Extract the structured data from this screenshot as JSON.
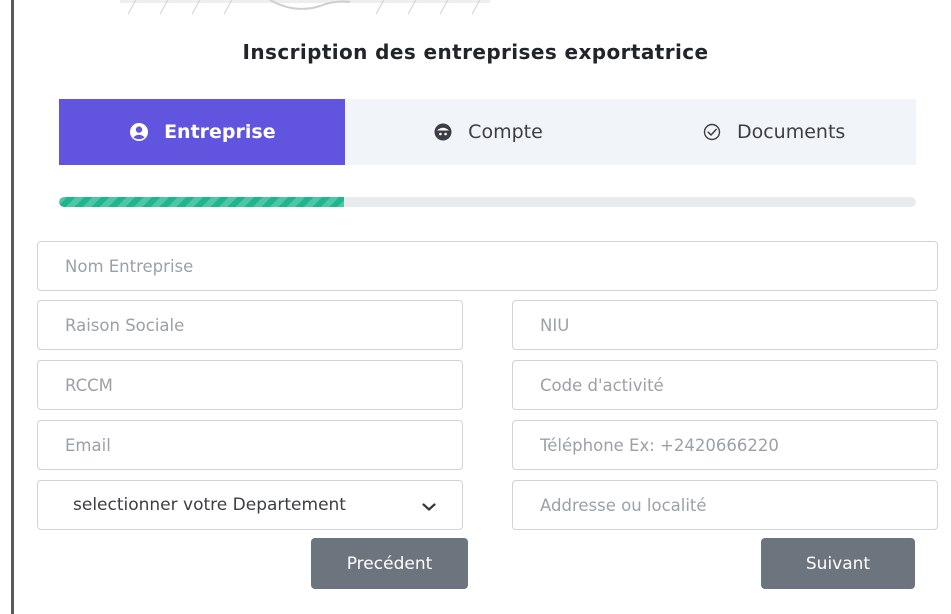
{
  "form": {
    "title": "Inscription des entreprises exportatrice",
    "progress_fraction": 0.333,
    "tabs": [
      {
        "label": "Entreprise",
        "icon": "user-circle-icon",
        "active": true
      },
      {
        "label": "Compte",
        "icon": "account-face-icon",
        "active": false
      },
      {
        "label": "Documents",
        "icon": "check-circle-icon",
        "active": false
      }
    ],
    "fields": {
      "nom_entreprise": {
        "placeholder": "Nom Entreprise",
        "value": ""
      },
      "raison_sociale": {
        "placeholder": "Raison Sociale",
        "value": ""
      },
      "niu": {
        "placeholder": "NIU",
        "value": ""
      },
      "rccm": {
        "placeholder": "RCCM",
        "value": ""
      },
      "code_activite": {
        "placeholder": "Code d'activité",
        "value": ""
      },
      "email": {
        "placeholder": "Email",
        "value": ""
      },
      "telephone": {
        "placeholder": "Téléphone Ex: +2420666220",
        "value": ""
      },
      "departement": {
        "selected": "selectionner votre Departement"
      },
      "adresse": {
        "placeholder": "Addresse ou localité",
        "value": ""
      }
    },
    "buttons": {
      "previous": "Precédent",
      "next": "Suivant"
    }
  },
  "colors": {
    "accent": "#6155e0",
    "progress": "#1fb58f",
    "button": "#6c757d",
    "tab_bg": "#f1f4f8"
  }
}
